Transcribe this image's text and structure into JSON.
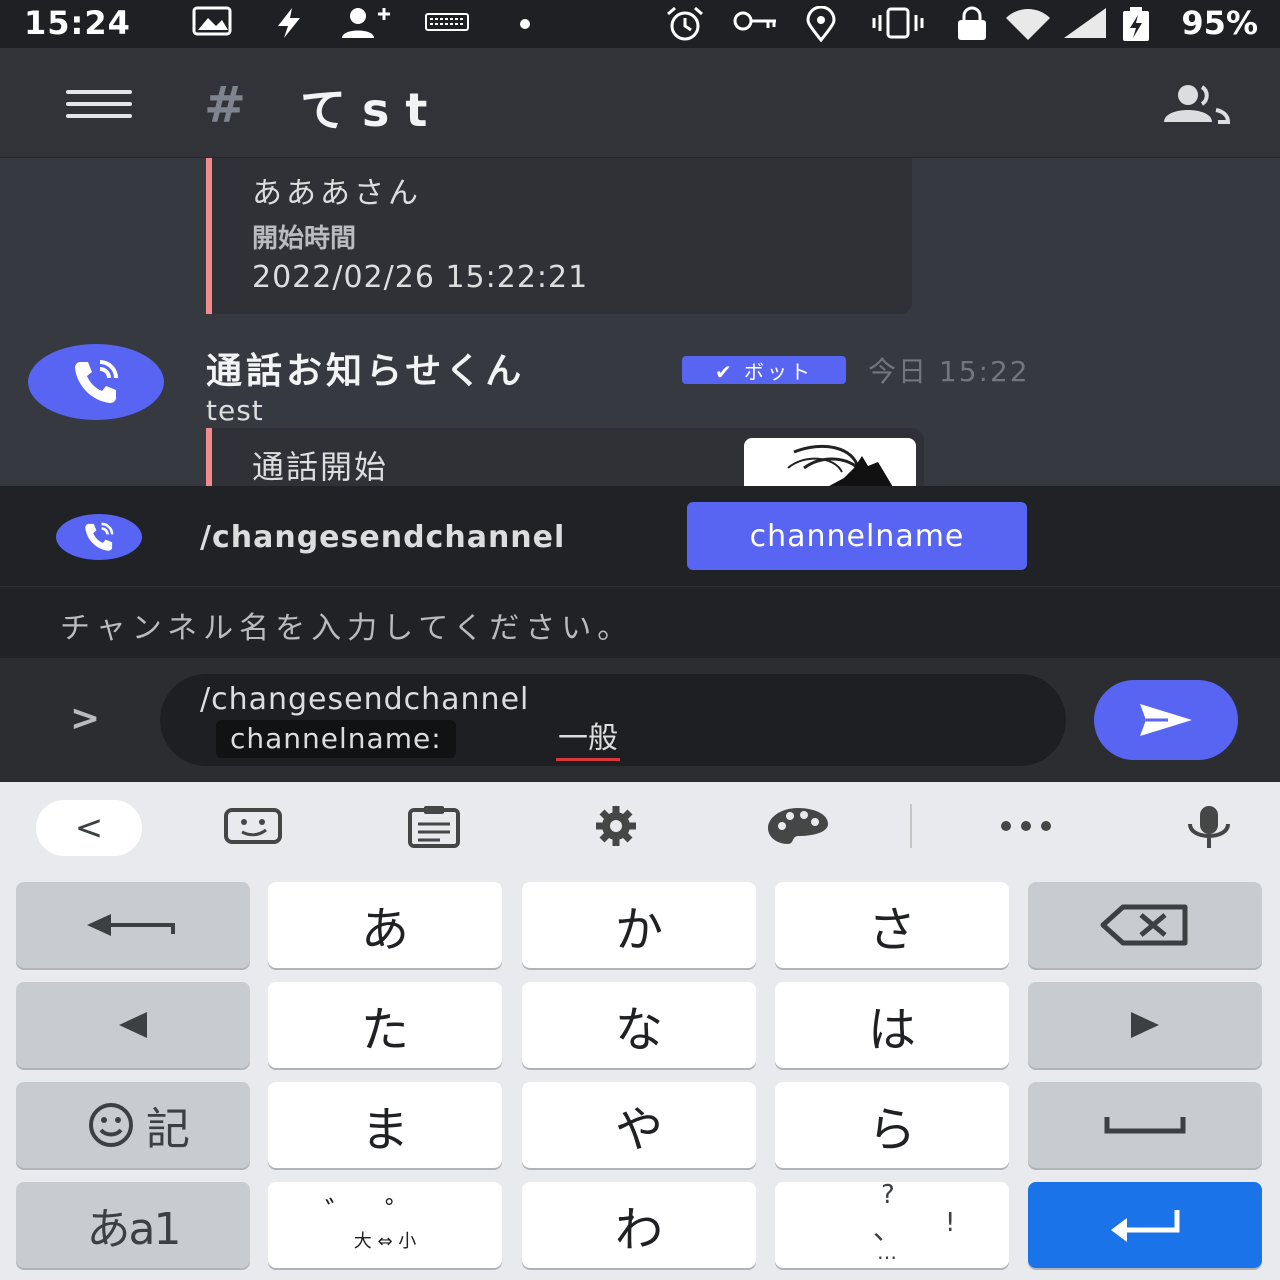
{
  "status_bar": {
    "time": "15:24",
    "battery": "95%"
  },
  "header": {
    "hash": "#",
    "channel": "てst"
  },
  "messages": {
    "embed1": {
      "name": "あああさん",
      "field_label": "開始時間",
      "field_value": "2022/02/26 15:22:21"
    },
    "message": {
      "author": "通話お知らせくん",
      "badge": "✔ ボット",
      "timestamp": "今日 15:22",
      "text": "test",
      "embed_title": "通話開始"
    }
  },
  "command": {
    "name": "/changesendchannel",
    "option_chip": "channelname",
    "description": "チャンネル名を入力してください。"
  },
  "composer": {
    "expand": ">",
    "line1": "/changesendchannel",
    "option_label": "channelname:",
    "option_value": "一般"
  },
  "keyboard": {
    "back": "<",
    "rows": [
      [
        "あ",
        "か",
        "さ"
      ],
      [
        "た",
        "な",
        "は"
      ],
      [
        "ま",
        "や",
        "ら"
      ],
      [
        "゛゜",
        "わ",
        "、。?!"
      ]
    ],
    "daishou": "大 ⇔ 小",
    "kigou": "記",
    "mode": "あa1",
    "punct_top": "?",
    "punct_mid": "、",
    "punct_excl": "!",
    "punct_bottom": "…"
  },
  "colors": {
    "accent": "#5865f2",
    "embed_bar": "#f28b8b",
    "enter_key": "#1a73e8"
  }
}
